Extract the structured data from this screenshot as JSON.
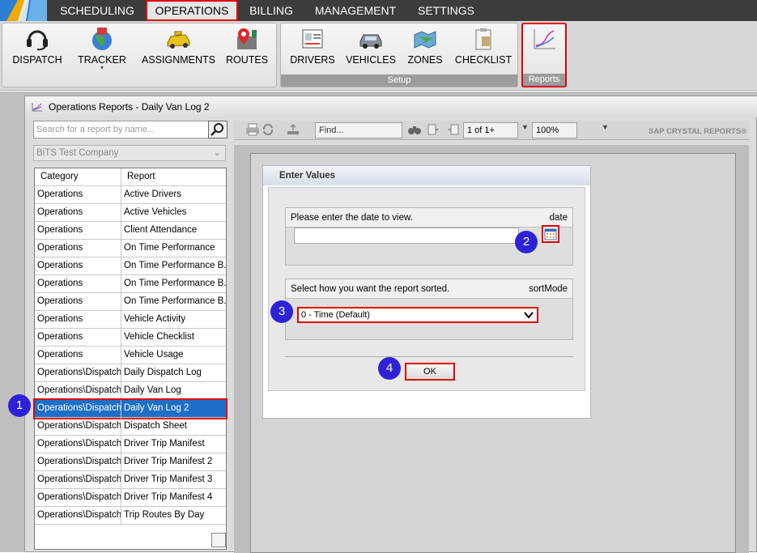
{
  "menu": {
    "items": [
      {
        "label": "SCHEDULING",
        "active": false
      },
      {
        "label": "OPERATIONS",
        "active": true
      },
      {
        "label": "BILLING",
        "active": false
      },
      {
        "label": "MANAGEMENT",
        "active": false
      },
      {
        "label": "SETTINGS",
        "active": false
      }
    ]
  },
  "ribbon": {
    "group1": {
      "buttons": [
        {
          "label": "DISPATCH",
          "icon": "headset-icon"
        },
        {
          "label": "TRACKER",
          "icon": "globe-flag-icon"
        },
        {
          "label": "ASSIGNMENTS",
          "icon": "taxi-icon"
        },
        {
          "label": "ROUTES",
          "icon": "map-pin-icon"
        }
      ]
    },
    "group2": {
      "caption": "Setup",
      "buttons": [
        {
          "label": "DRIVERS",
          "icon": "id-card-icon"
        },
        {
          "label": "VEHICLES",
          "icon": "car-icon"
        },
        {
          "label": "ZONES",
          "icon": "map-icon"
        },
        {
          "label": "CHECKLIST",
          "icon": "clipboard-icon"
        }
      ]
    },
    "group3": {
      "caption": "Reports",
      "icon": "chart-icon"
    }
  },
  "window": {
    "title": "Operations Reports - Daily Van Log 2"
  },
  "left": {
    "search_placeholder": "Search for a report by name...",
    "company": "BiTS Test Company",
    "headers": {
      "category": "Category",
      "report": "Report"
    },
    "rows": [
      {
        "category": "Operations",
        "report": "Active Drivers"
      },
      {
        "category": "Operations",
        "report": "Active Vehicles"
      },
      {
        "category": "Operations",
        "report": "Client Attendance"
      },
      {
        "category": "Operations",
        "report": "On Time Performance"
      },
      {
        "category": "Operations",
        "report": "On Time Performance B..."
      },
      {
        "category": "Operations",
        "report": "On Time Performance B..."
      },
      {
        "category": "Operations",
        "report": "On Time Performance B..."
      },
      {
        "category": "Operations",
        "report": "Vehicle Activity"
      },
      {
        "category": "Operations",
        "report": "Vehicle Checklist"
      },
      {
        "category": "Operations",
        "report": "Vehicle Usage"
      },
      {
        "category": "Operations\\Dispatch",
        "report": "Daily Dispatch Log"
      },
      {
        "category": "Operations\\Dispatch",
        "report": "Daily Van Log"
      },
      {
        "category": "Operations\\Dispatch",
        "report": "Daily Van Log 2"
      },
      {
        "category": "Operations\\Dispatch",
        "report": "Dispatch Sheet"
      },
      {
        "category": "Operations\\Dispatch",
        "report": "Driver Trip Manifest"
      },
      {
        "category": "Operations\\Dispatch",
        "report": "Driver Trip Manifest 2"
      },
      {
        "category": "Operations\\Dispatch",
        "report": "Driver Trip Manifest 3"
      },
      {
        "category": "Operations\\Dispatch",
        "report": "Driver Trip Manifest 4"
      },
      {
        "category": "Operations\\Dispatch",
        "report": "Trip Routes By Day"
      }
    ],
    "selected_index": 12
  },
  "viewer": {
    "find_placeholder": "Find...",
    "page_indicator": "1 of 1+",
    "zoom": "100%",
    "brand": "SAP CRYSTAL REPORTS®"
  },
  "dialog": {
    "title": "Enter Values",
    "date_prompt": "Please enter the date to view.",
    "date_param": "date",
    "date_value": "",
    "sort_prompt": "Select how you want the report sorted.",
    "sort_param": "sortMode",
    "sort_value": "0 - Time (Default)",
    "ok_label": "OK"
  },
  "badges": [
    "1",
    "2",
    "3",
    "4"
  ],
  "colors": {
    "highlight": "#e00000",
    "badge": "#2e22d8",
    "selection": "#1e6fc6"
  }
}
